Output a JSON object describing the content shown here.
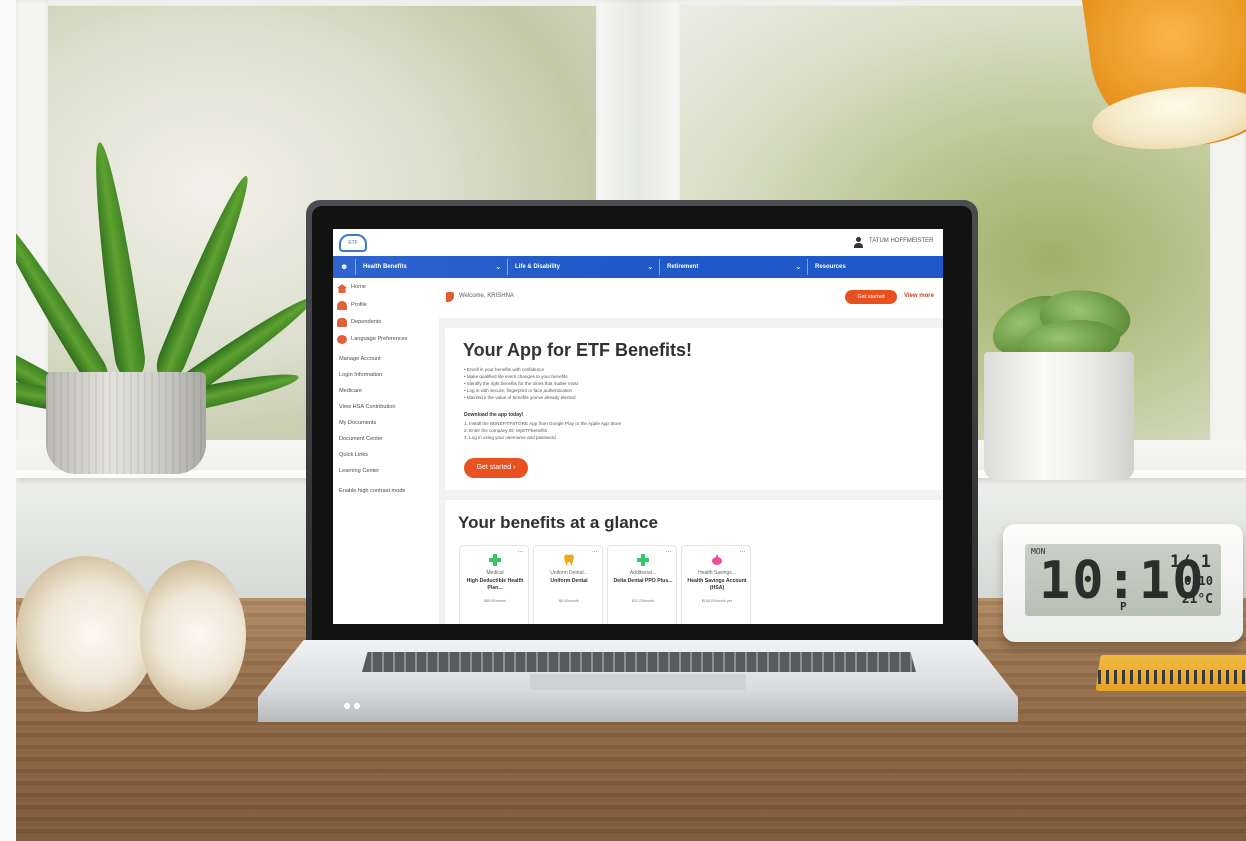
{
  "screen": {
    "user_name": "TATUM HOFFMEISTER",
    "nav": [
      {
        "label": "Health Benefits"
      },
      {
        "label": "Life & Disability"
      },
      {
        "label": "Retirement"
      },
      {
        "label": "Resources"
      }
    ],
    "sidebar": [
      {
        "label": "Home"
      },
      {
        "label": "Profile"
      },
      {
        "label": "Dependents"
      },
      {
        "label": "Language Preferences"
      },
      {
        "label": "Manage Account"
      },
      {
        "label": "Login Information"
      },
      {
        "label": "Medicare"
      },
      {
        "label": "View HSA Contribution"
      },
      {
        "label": "My Documents"
      },
      {
        "label": "Document Center"
      },
      {
        "label": "Quick Links"
      },
      {
        "label": "Learning Center"
      },
      {
        "label": "Enable high contrast mode"
      }
    ],
    "welcome": "Welcome, KRISHNA",
    "get_started_small": "Get started",
    "view_more": "View more",
    "hero": {
      "title": "Your App for ETF Benefits!",
      "bullets": [
        "• Enroll in your benefits with confidence",
        "• Make qualified life event changes to your benefits",
        "• Identify the right benefits for the times that matter most",
        "• Log in with secure, fingerprint or face authentication",
        "• Maximize the value of benefits you've already elected"
      ],
      "download_title": "Download the app today!",
      "steps": [
        "1. Install the BENEFITFSTORE App from Google Play or the Apple App Store",
        "2. Enter the company ID: MyETFbenefits",
        "3. Log in using your username and password"
      ],
      "button": "Get started ›"
    },
    "glance_title": "Your benefits at a glance",
    "cards": [
      {
        "type": "Medical",
        "name": "High Deductible Health Plan...",
        "price": "$85.00/month",
        "icon": "medical-cross-icon",
        "color": "#3cc46a"
      },
      {
        "type": "Uniform Dental...",
        "name": "Uniform Dental",
        "price": "$6.00/month",
        "icon": "tooth-icon",
        "color": "#f2a81d"
      },
      {
        "type": "Additional...",
        "name": "Delta Dental PPO Plus...",
        "price": "$12.23/month",
        "icon": "medical-cross-icon",
        "color": "#3cc46a"
      },
      {
        "type": "Health Savings...",
        "name": "Health Savings Account (HSA)",
        "price": "$100.00/month per",
        "icon": "piggy-bank-icon",
        "color": "#e94f9a"
      }
    ]
  },
  "clock": {
    "day": "MON",
    "time": "10:10",
    "meridiem": "P",
    "date": "1/ 1",
    "seconds": "10:10",
    "temperature": "21°C"
  },
  "colors": {
    "nav_blue": "#1e58c9",
    "accent_orange": "#e8501f"
  }
}
